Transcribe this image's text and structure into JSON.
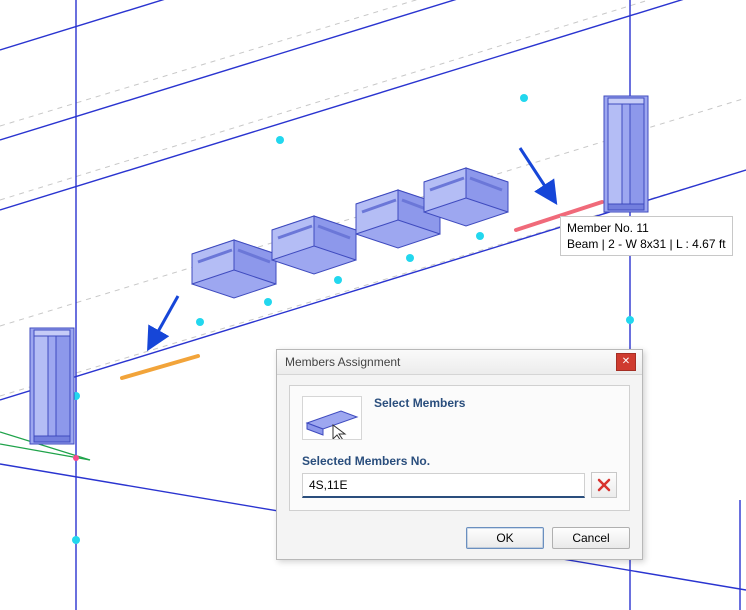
{
  "colors": {
    "line_primary": "#2a34d0",
    "line_highlight_start": "#f2a43a",
    "line_highlight_end": "#f06a7a",
    "line_green": "#1fa34a",
    "node_cyan": "#22d7ee",
    "node_pink": "#f74a8c",
    "beam_fill": "#9da7f0",
    "beam_stroke": "#3f4bbf",
    "arrow": "#1646d8"
  },
  "tooltip": {
    "line1": "Member No. 11",
    "line2": "Beam | 2 - W 8x31 | L : 4.67 ft"
  },
  "dialog": {
    "title": "Members Assignment",
    "select_label": "Select Members",
    "selected_header": "Selected Members No.",
    "input_value": "4S,11E",
    "ok_label": "OK",
    "cancel_label": "Cancel",
    "close_x": "✕"
  },
  "icons": {
    "clear": "close-x-red"
  }
}
